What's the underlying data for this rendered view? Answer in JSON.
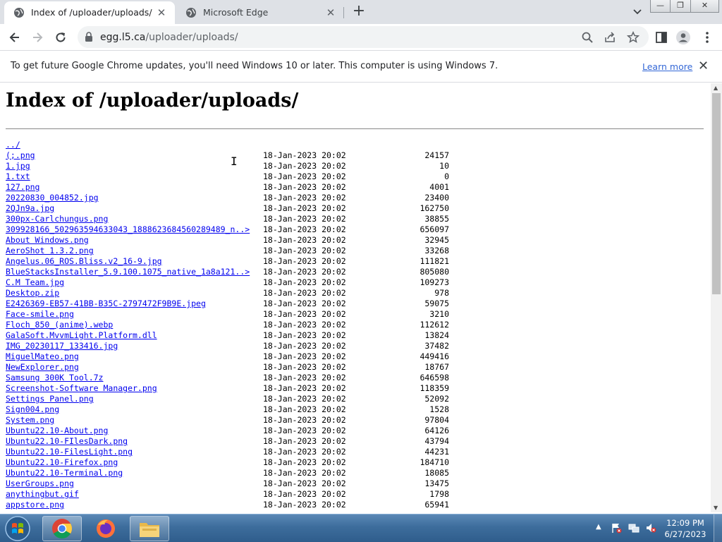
{
  "tabs": [
    {
      "title": "Index of /uploader/uploads/",
      "active": true,
      "icon": "globe-icon"
    },
    {
      "title": "Microsoft Edge",
      "active": false,
      "icon": "globe-icon"
    }
  ],
  "window_controls": {
    "minimize": "—",
    "maximize": "❐",
    "close": "✕"
  },
  "omnibox": {
    "host": "egg.l5.ca",
    "path": "/uploader/uploads/"
  },
  "infobar": {
    "message": "To get future Google Chrome updates, you'll need Windows 10 or later. This computer is using Windows 7.",
    "link": "Learn more"
  },
  "page": {
    "heading": "Index of /uploader/uploads/",
    "entries": [
      {
        "name": "../",
        "date": "",
        "size": ""
      },
      {
        "name": "(;.png",
        "date": "18-Jan-2023 20:02",
        "size": "24157"
      },
      {
        "name": "1.jpg",
        "date": "18-Jan-2023 20:02",
        "size": "10"
      },
      {
        "name": "1.txt",
        "date": "18-Jan-2023 20:02",
        "size": "0"
      },
      {
        "name": "127.png",
        "date": "18-Jan-2023 20:02",
        "size": "4001"
      },
      {
        "name": "20220830_004852.jpg",
        "date": "18-Jan-2023 20:02",
        "size": "23400"
      },
      {
        "name": "2QJn9a.jpg",
        "date": "18-Jan-2023 20:02",
        "size": "162750"
      },
      {
        "name": "300px-Carlchungus.png",
        "date": "18-Jan-2023 20:02",
        "size": "38855"
      },
      {
        "name": "309928166_502963594633043_1888623684560289489_n..>",
        "date": "18-Jan-2023 20:02",
        "size": "656097"
      },
      {
        "name": "About Windows.png",
        "date": "18-Jan-2023 20:02",
        "size": "32945"
      },
      {
        "name": "AeroShot 1.3.2.png",
        "date": "18-Jan-2023 20:02",
        "size": "33268"
      },
      {
        "name": "Angelus.06_ROS.Bliss.v2_16-9.jpg",
        "date": "18-Jan-2023 20:02",
        "size": "111821"
      },
      {
        "name": "BlueStacksInstaller_5.9.100.1075_native_1a8a121..>",
        "date": "18-Jan-2023 20:02",
        "size": "805080"
      },
      {
        "name": "C.M Team.jpg",
        "date": "18-Jan-2023 20:02",
        "size": "109273"
      },
      {
        "name": "Desktop.zip",
        "date": "18-Jan-2023 20:02",
        "size": "978"
      },
      {
        "name": "E2426369-EB57-41BB-B35C-2797472F9B9E.jpeg",
        "date": "18-Jan-2023 20:02",
        "size": "59075"
      },
      {
        "name": "Face-smile.png",
        "date": "18-Jan-2023 20:02",
        "size": "3210"
      },
      {
        "name": "Floch_850_(anime).webp",
        "date": "18-Jan-2023 20:02",
        "size": "112612"
      },
      {
        "name": "GalaSoft.MvvmLight.Platform.dll",
        "date": "18-Jan-2023 20:02",
        "size": "13824"
      },
      {
        "name": "IMG_20230117_133416.jpg",
        "date": "18-Jan-2023 20:02",
        "size": "37482"
      },
      {
        "name": "MiguelMateo.png",
        "date": "18-Jan-2023 20:02",
        "size": "449416"
      },
      {
        "name": "NewExplorer.png",
        "date": "18-Jan-2023 20:02",
        "size": "18767"
      },
      {
        "name": "Samsung 300K Tool.7z",
        "date": "18-Jan-2023 20:02",
        "size": "646598"
      },
      {
        "name": "Screenshot-Software Manager.png",
        "date": "18-Jan-2023 20:02",
        "size": "118359"
      },
      {
        "name": "Settings Panel.png",
        "date": "18-Jan-2023 20:02",
        "size": "52092"
      },
      {
        "name": "Sign004.png",
        "date": "18-Jan-2023 20:02",
        "size": "1528"
      },
      {
        "name": "System.png",
        "date": "18-Jan-2023 20:02",
        "size": "97804"
      },
      {
        "name": "Ubuntu22.10-About.png",
        "date": "18-Jan-2023 20:02",
        "size": "64126"
      },
      {
        "name": "Ubuntu22.10-FIlesDark.png",
        "date": "18-Jan-2023 20:02",
        "size": "43794"
      },
      {
        "name": "Ubuntu22.10-FilesLight.png",
        "date": "18-Jan-2023 20:02",
        "size": "44231"
      },
      {
        "name": "Ubuntu22.10-Firefox.png",
        "date": "18-Jan-2023 20:02",
        "size": "184710"
      },
      {
        "name": "Ubuntu22.10-Terminal.png",
        "date": "18-Jan-2023 20:02",
        "size": "18085"
      },
      {
        "name": "UserGroups.png",
        "date": "18-Jan-2023 20:02",
        "size": "13475"
      },
      {
        "name": "anythingbut.gif",
        "date": "18-Jan-2023 20:02",
        "size": "1798"
      },
      {
        "name": "appstore.png",
        "date": "18-Jan-2023 20:02",
        "size": "65941"
      }
    ]
  },
  "taskbar": {
    "apps": [
      "chrome-icon",
      "firefox-icon",
      "file-explorer-icon"
    ],
    "clock": {
      "time": "12:09 PM",
      "date": "6/27/2023"
    }
  },
  "colors": {
    "link": "#0000ee",
    "tabstrip": "#dee1e6",
    "taskbar": "#3d6d9c"
  }
}
